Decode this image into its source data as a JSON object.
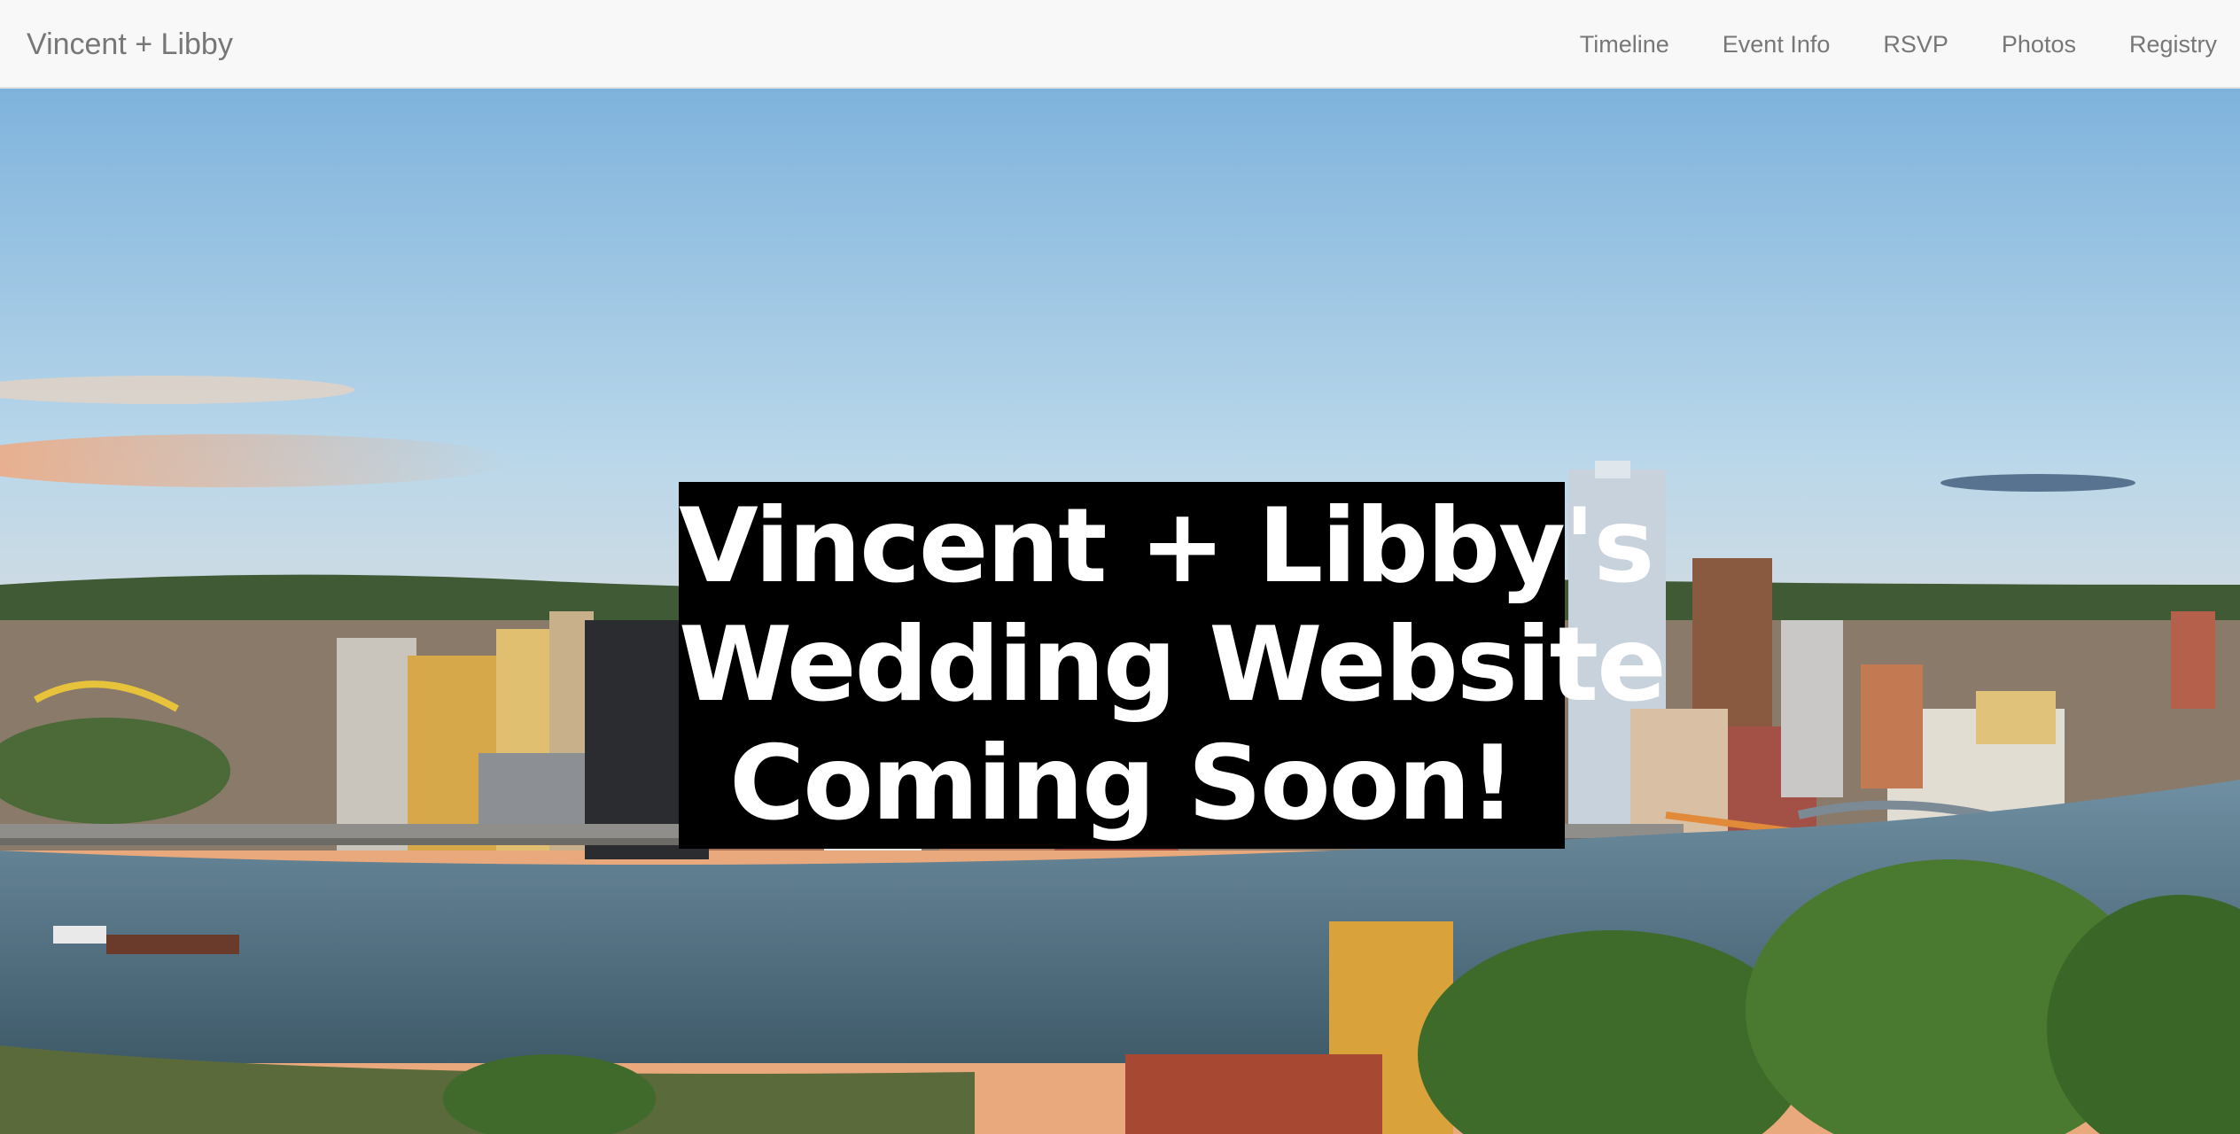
{
  "navbar": {
    "brand": "Vincent + Libby",
    "links": [
      {
        "label": "Timeline"
      },
      {
        "label": "Event Info"
      },
      {
        "label": "RSVP"
      },
      {
        "label": "Photos"
      },
      {
        "label": "Registry"
      }
    ]
  },
  "hero": {
    "image_alt": "Pittsburgh skyline panorama at sunset over the river",
    "headline_lines": [
      "Vincent + Libby's",
      "Wedding Website",
      "Coming Soon!"
    ]
  },
  "colors": {
    "navbar_bg": "#f8f8f8",
    "nav_text": "#777777",
    "headline_bg": "#000000",
    "headline_text": "#ffffff",
    "sky_top": "#7fb3dc",
    "sky_horizon": "#f3c28f",
    "river": "#4f6e80"
  }
}
